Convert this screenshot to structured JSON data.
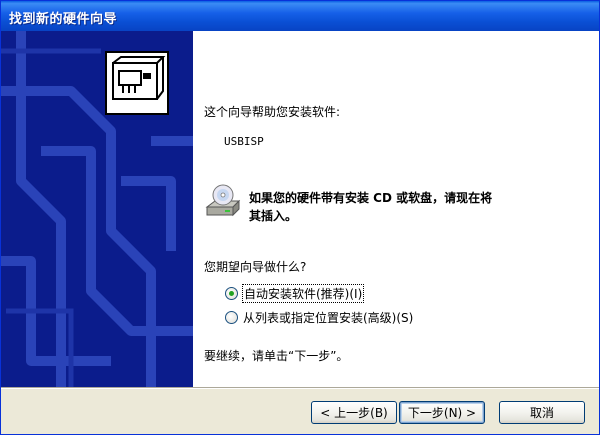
{
  "window": {
    "title": "找到新的硬件向导"
  },
  "content": {
    "intro": "这个向导帮助您安装软件:",
    "device_name": "USBISP",
    "cd_prompt_line1": "如果您的硬件带有安装 CD 或软盘，请现在将",
    "cd_prompt_line2": "其插入。",
    "question": "您期望向导做什么?",
    "options": [
      {
        "label": "自动安装软件(推荐)(I)",
        "selected": true
      },
      {
        "label": "从列表或指定位置安装(高级)(S)",
        "selected": false
      }
    ],
    "continue_text": "要继续，请单击“下一步”。"
  },
  "buttons": {
    "back": "< 上一步(B)",
    "next": "下一步(N) >",
    "cancel": "取消"
  },
  "icons": {
    "sidebar": "hardware-card-icon",
    "cd": "cd-drive-icon"
  }
}
